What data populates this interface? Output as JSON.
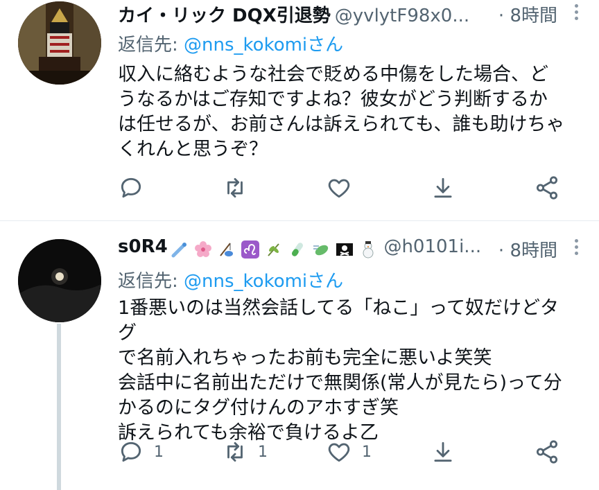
{
  "tweets": [
    {
      "name": "カイ・リック DQX引退勢",
      "handle": "@yvlytF98x0...",
      "time": "· 8時間",
      "reply_prefix": "返信先: ",
      "reply_mention": "@nns_kokomiさん",
      "text": "収入に絡むような社会で貶める中傷をした場合、ど\nうなるかはご存知ですよね？彼女がどう判断するか\nは任せるが、お前さんは訴えられても、誰も助けちゃ\nくれんと思うぞ？",
      "avatar": "samurai-armor-photo",
      "counts": {
        "reply": "",
        "retweet": "",
        "like": ""
      }
    },
    {
      "name": "s0R4",
      "name_emojis": [
        "comet",
        "cherry-blossom",
        "fishing-pole",
        "leo-sign",
        "herb",
        "test-tube",
        "leaf-wind",
        "pirate-flag",
        "snowman"
      ],
      "handle": "@h0101i...",
      "time": "· 8時間",
      "reply_prefix": "返信先: ",
      "reply_mention": "@nns_kokomiさん",
      "text": "1番悪いのは当然会話してる「ねこ」って奴だけどタグ\nで名前入れちゃったお前も完全に悪いよ笑笑\n会話中に名前出ただけで無関係(常人が見たら)って分\nかるのにタグ付けんのアホすぎ笑\n訴えられても余裕で負けるよ乙",
      "avatar": "moon-night-photo",
      "counts": {
        "reply": "1",
        "retweet": "1",
        "like": "1"
      }
    }
  ],
  "colors": {
    "text": "#0f1419",
    "secondary": "#536471",
    "link": "#1d9bf0",
    "divider": "#e6ecf0",
    "thread_line": "#cfd9de"
  },
  "icons": [
    "reply-icon",
    "retweet-icon",
    "like-icon",
    "download-icon",
    "share-icon",
    "more-icon"
  ]
}
